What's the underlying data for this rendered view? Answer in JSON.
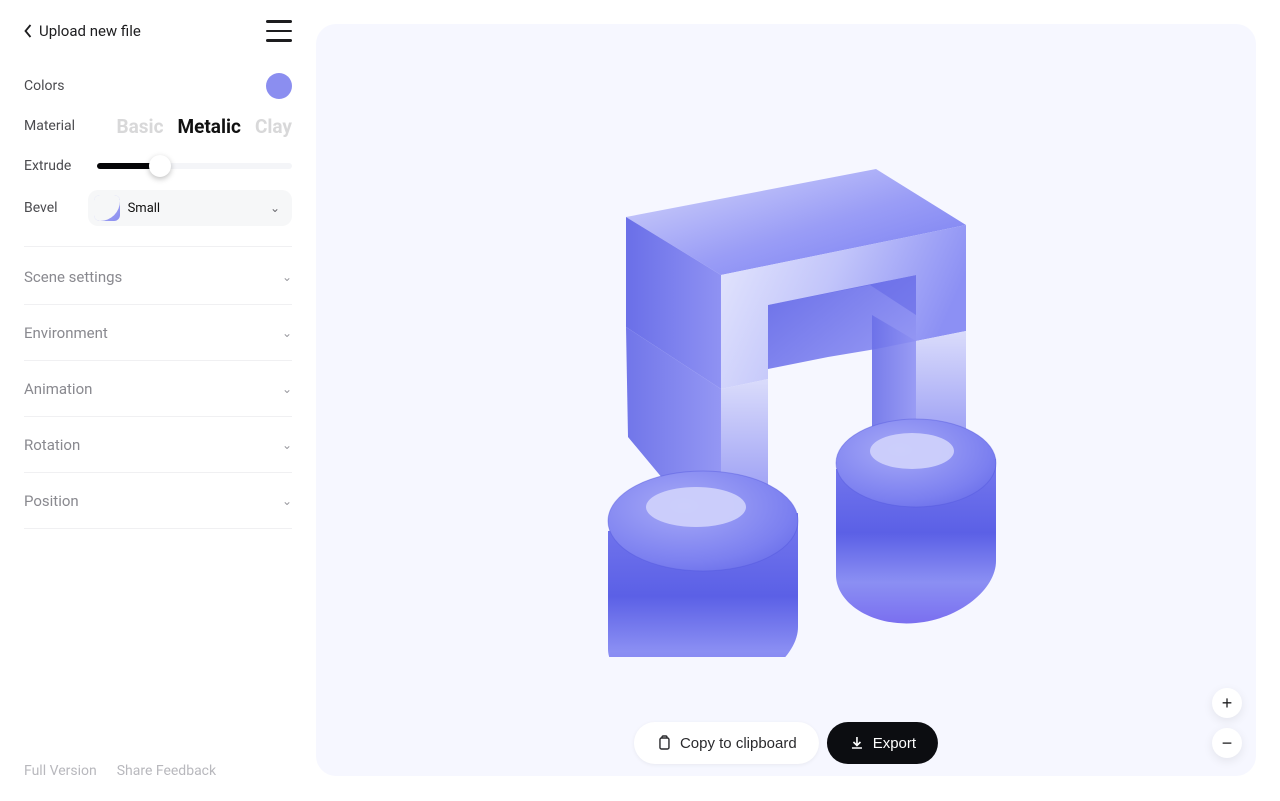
{
  "header": {
    "upload_label": "Upload new file"
  },
  "panel": {
    "colors_label": "Colors",
    "color_value": "#8b8ef0",
    "material_label": "Material",
    "material_options": {
      "basic": "Basic",
      "metalic": "Metalic",
      "clay": "Clay"
    },
    "extrude_label": "Extrude",
    "bevel_label": "Bevel",
    "bevel_value": "Small"
  },
  "sections": {
    "scene": "Scene settings",
    "environment": "Environment",
    "animation": "Animation",
    "rotation": "Rotation",
    "position": "Position"
  },
  "footer": {
    "full_version": "Full Version",
    "share_feedback": "Share Feedback"
  },
  "actions": {
    "copy": "Copy to clipboard",
    "export": "Export"
  }
}
